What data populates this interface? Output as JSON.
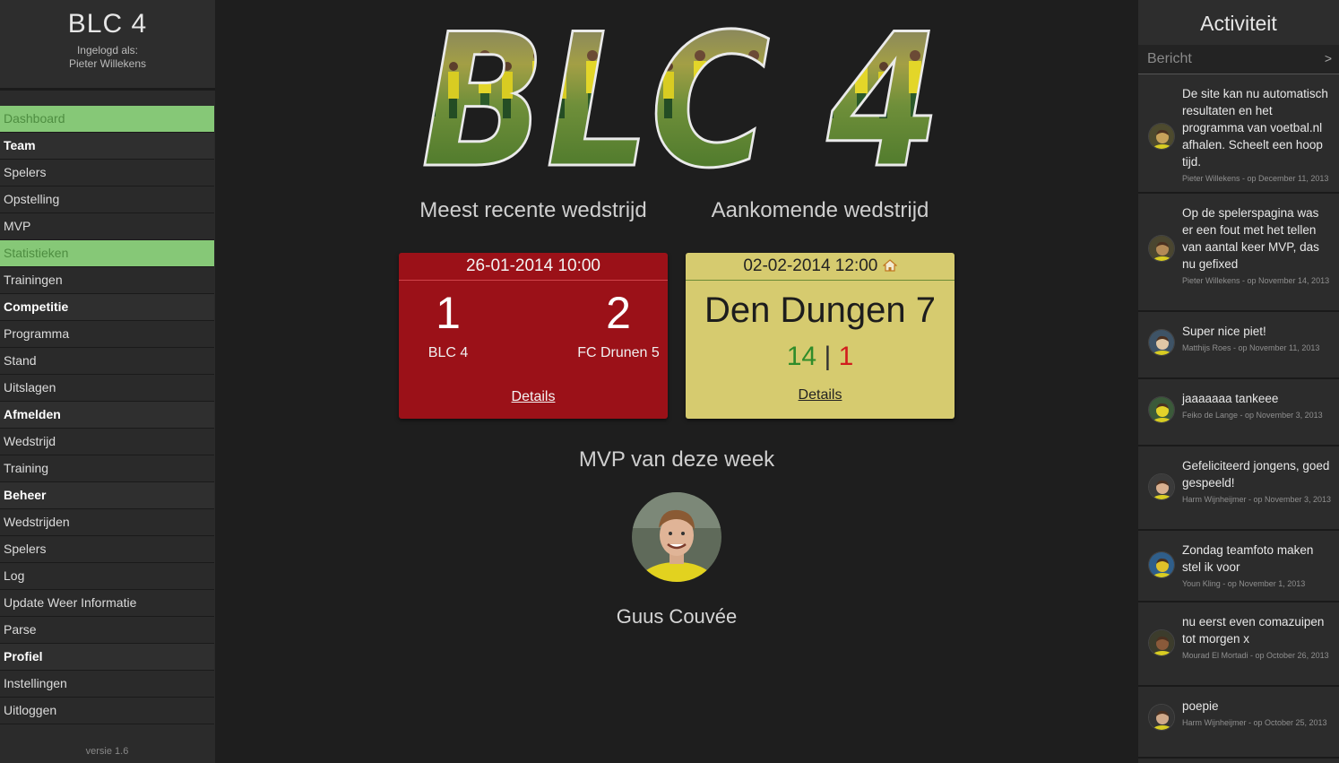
{
  "brand": {
    "title": "BLC 4",
    "logged_in_label": "Ingelogd als:",
    "user": "Pieter Willekens"
  },
  "menu": [
    {
      "label": "Dashboard",
      "type": "item",
      "active": true
    },
    {
      "label": "Team",
      "type": "header"
    },
    {
      "label": "Spelers",
      "type": "item"
    },
    {
      "label": "Opstelling",
      "type": "item"
    },
    {
      "label": "MVP",
      "type": "item"
    },
    {
      "label": "Statistieken",
      "type": "item",
      "active": true
    },
    {
      "label": "Trainingen",
      "type": "item"
    },
    {
      "label": "Competitie",
      "type": "header"
    },
    {
      "label": "Programma",
      "type": "item"
    },
    {
      "label": "Stand",
      "type": "item"
    },
    {
      "label": "Uitslagen",
      "type": "item"
    },
    {
      "label": "Afmelden",
      "type": "header"
    },
    {
      "label": "Wedstrijd",
      "type": "item"
    },
    {
      "label": "Training",
      "type": "item"
    },
    {
      "label": "Beheer",
      "type": "header"
    },
    {
      "label": "Wedstrijden",
      "type": "item"
    },
    {
      "label": "Spelers",
      "type": "item"
    },
    {
      "label": "Log",
      "type": "item"
    },
    {
      "label": "Update Weer Informatie",
      "type": "item"
    },
    {
      "label": "Parse",
      "type": "item"
    },
    {
      "label": "Profiel",
      "type": "header"
    },
    {
      "label": "Instellingen",
      "type": "item"
    },
    {
      "label": "Uitloggen",
      "type": "item"
    }
  ],
  "version": "versie 1.6",
  "main": {
    "logo_text": "BLC 4",
    "recent_heading": "Meest recente wedstrijd",
    "upcoming_heading": "Aankomende wedstrijd",
    "recent": {
      "date": "26-01-2014 10:00",
      "home_score": "1",
      "away_score": "2",
      "home_team": "BLC 4",
      "away_team": "FC Drunen 5",
      "details": "Details"
    },
    "upcoming": {
      "date": "02-02-2014 12:00",
      "home_icon": "home-icon",
      "opponent": "Den Dungen 7",
      "wins": "14",
      "separator": "|",
      "losses": "1",
      "details": "Details"
    },
    "mvp_heading": "MVP van deze week",
    "mvp_name": "Guus Couvée"
  },
  "activity": {
    "title": "Activiteit",
    "placeholder": "Bericht",
    "send_label": ">",
    "items": [
      {
        "text": "De site kan nu automatisch resultaten en het programma van voetbal.nl afhalen. Scheelt een hoop tijd.",
        "meta": "Pieter Willekens - op December 11, 2013"
      },
      {
        "text": "Op de spelerspagina was er een fout met het tellen van aantal keer MVP, das nu gefixed",
        "meta": "Pieter Willekens - op November 14, 2013"
      },
      {
        "text": "Super nice piet!",
        "meta": "Matthijs Roes - op November 11, 2013"
      },
      {
        "text": "jaaaaaaa tankeee",
        "meta": "Feiko de Lange - op November 3, 2013"
      },
      {
        "text": "Gefeliciteerd jongens, goed gespeeld!",
        "meta": "Harm Wijnheijmer - op November 3, 2013"
      },
      {
        "text": "Zondag teamfoto maken stel ik voor",
        "meta": "Youn Kling - op November 1, 2013"
      },
      {
        "text": "nu eerst even comazuipen tot morgen x",
        "meta": "Mourad El Mortadi - op October 26, 2013"
      },
      {
        "text": "poepie",
        "meta": "Harm Wijnheijmer - op October 25, 2013"
      }
    ]
  },
  "colors": {
    "active_menu": "#86c877",
    "recent_card": "#9b1118",
    "upcoming_card": "#d6cb6f",
    "win": "#2f8c2a",
    "loss": "#d11d1d"
  }
}
